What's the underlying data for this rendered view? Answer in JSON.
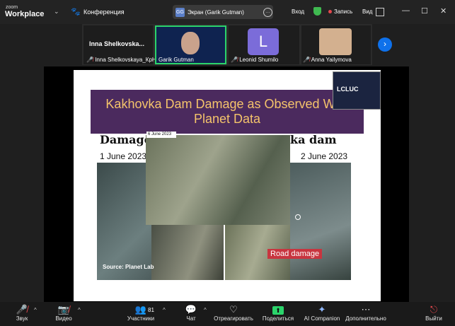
{
  "app": {
    "logo_top": "zoom",
    "logo_bottom": "Workplace",
    "meeting_label": "Конференция"
  },
  "header": {
    "screen_share_label": "Экран (Garik Gutman)",
    "screen_avatar_initials": "GG",
    "sign_in": "Вход",
    "record": "Запись",
    "view": "Вид",
    "window_minimize": "—",
    "window_restore": "☐",
    "window_close": "✕"
  },
  "participants": [
    {
      "name": "Inna Shelkovskaya_КрНУ",
      "display_title": "Inna  Shelkovska...",
      "muted": true
    },
    {
      "name": "Garik Gutman",
      "muted": false
    },
    {
      "name": "Leonid Shumilo",
      "initial": "L",
      "muted": true
    },
    {
      "name": "Anna Yailymova",
      "muted": true
    }
  ],
  "slide": {
    "title": "Kakhovka Dam Damage as Observed With Planet Data",
    "left_heading": "Damage",
    "right_heading": "ka dam",
    "date_left": "1 June 2023",
    "date_right": "2 June 2023",
    "date_center": "6 June 2023",
    "road_label": "Road damage",
    "source": "Source: Planet Lab",
    "logo_text": "LCLUC"
  },
  "toolbar": {
    "mute": "Звук",
    "video": "Видео",
    "participants": "Участники",
    "participants_count": "81",
    "chat": "Чат",
    "react": "Отреагировать",
    "share": "Поделиться",
    "ai": "AI Companion",
    "more": "Дополнительно",
    "leave": "Выйти"
  },
  "colors": {
    "accent_green": "#2bd46b",
    "blue_button": "#0e71eb",
    "record_red": "#e5484d",
    "banner": "#4b2a5e",
    "road_tag": "#c8353f"
  }
}
